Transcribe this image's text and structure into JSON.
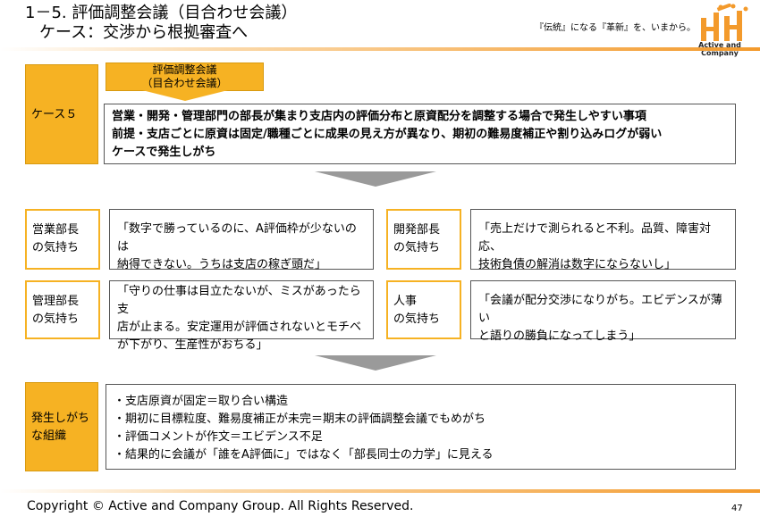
{
  "header": {
    "title_line1": "1－5. 評価調整会議（目合わせ会議）",
    "title_line2": "ケース：交渉から根拠審査へ",
    "tagline": "『伝統』になる『革新』を、いまから。",
    "logo_text": "Active and Company"
  },
  "case": {
    "label": "ケース５",
    "meeting_title": "評価調整会議",
    "meeting_subtitle": "（目合わせ会議）",
    "description_line1": "営業・開発・管理部門の部長が集まり支店内の評価分布と原資配分を調整する場合で発生しやすい事項",
    "description_line2": "前提・支店ごとに原資は固定/職種ごとに成果の見え方が異なり、期初の難易度補正や割り込みログが弱い",
    "description_line3": "ケースで発生しがち"
  },
  "feelings": [
    {
      "label_line1": "営業部長",
      "label_line2": "の気持ち",
      "quote_line1": "「数字で勝っているのに、A評価枠が少ないのは",
      "quote_line2": "納得できない。うちは支店の稼ぎ頭だ」",
      "quote_line3": ""
    },
    {
      "label_line1": "開発部長",
      "label_line2": "の気持ち",
      "quote_line1": "「売上だけで測られると不利。品質、障害対応、",
      "quote_line2": "技術負債の解消は数字にならないし」",
      "quote_line3": ""
    },
    {
      "label_line1": "管理部長",
      "label_line2": "の気持ち",
      "quote_line1": "「守りの仕事は目立たないが、ミスがあったら支",
      "quote_line2": "店が止まる。安定運用が評価されないとモチベ",
      "quote_line3": "が下がり、生産性がおちる」"
    },
    {
      "label_line1": "人事",
      "label_line2": "の気持ち",
      "quote_line1": "「会議が配分交渉になりがち。エビデンスが薄い",
      "quote_line2": "と語りの勝負になってしまう」",
      "quote_line3": ""
    }
  ],
  "organization": {
    "label_line1": "発生しがち",
    "label_line2": "な組織",
    "points": [
      "・支店原資が固定＝取り合い構造",
      "・期初に目標粒度、難易度補正が未完＝期末の評価調整会議でもめがち",
      "・評価コメントが作文＝エビデンス不足",
      "・結果的に会議が「誰をA評価に」ではなく「部長同士の力学」に見える"
    ]
  },
  "footer": {
    "copyright": "Copyright © Active and Company Group. All Rights Reserved.",
    "page_number": "47"
  }
}
